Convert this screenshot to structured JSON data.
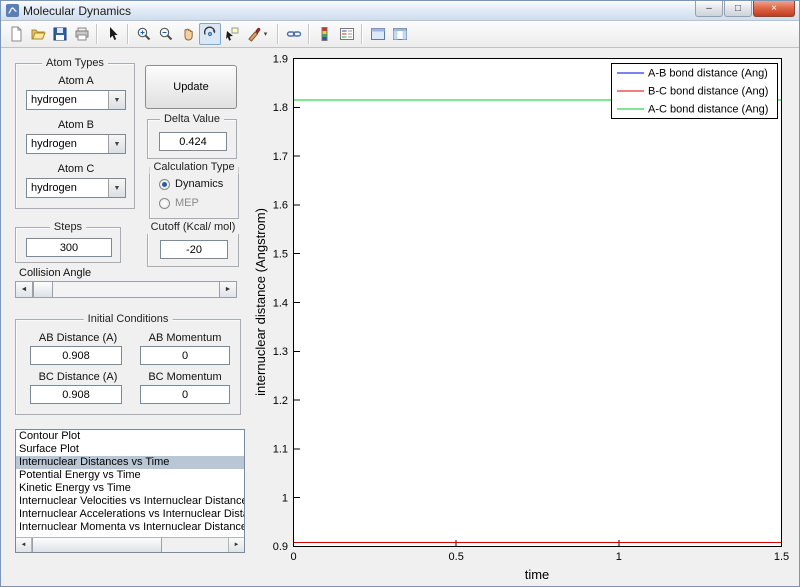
{
  "window": {
    "title": "Molecular Dynamics",
    "controls": {
      "minimize": "–",
      "maximize": "□",
      "close": "×"
    }
  },
  "toolbar": {
    "icons": [
      "new-figure",
      "open-file",
      "save-figure",
      "print-figure",
      "edit-plot",
      "zoom-in",
      "zoom-out",
      "pan",
      "rotate-3d",
      "data-cursor",
      "brush-data",
      "link-plot",
      "insert-colorbar",
      "insert-legend",
      "hide-plot-tools",
      "show-plot-tools"
    ]
  },
  "panels": {
    "atom_types": {
      "title": "Atom Types",
      "atoms": [
        {
          "label": "Atom A",
          "value": "hydrogen"
        },
        {
          "label": "Atom B",
          "value": "hydrogen"
        },
        {
          "label": "Atom C",
          "value": "hydrogen"
        }
      ]
    },
    "update_button": "Update",
    "delta": {
      "title": "Delta Value",
      "value": "0.424"
    },
    "calculation_type": {
      "title": "Calculation Type",
      "options": [
        {
          "label": "Dynamics",
          "selected": true
        },
        {
          "label": "MEP",
          "selected": false
        }
      ]
    },
    "steps": {
      "title": "Steps",
      "value": "300"
    },
    "cutoff": {
      "title": "Cutoff (Kcal/ mol)",
      "value": "-20"
    },
    "collision_angle": {
      "label": "Collision Angle"
    },
    "initial_conditions": {
      "title": "Initial Conditions",
      "fields": [
        {
          "label": "AB Distance (A)",
          "value": "0.908"
        },
        {
          "label": "AB Momentum",
          "value": "0"
        },
        {
          "label": "BC Distance (A)",
          "value": "0.908"
        },
        {
          "label": "BC Momentum",
          "value": "0"
        }
      ]
    },
    "plot_list": {
      "selected_index": 2,
      "items": [
        "Contour Plot",
        "Surface Plot",
        "Internuclear Distances vs Time",
        "Potential Energy vs Time",
        "Kinetic Energy vs Time",
        "Internuclear Velocities vs Internuclear Distance",
        "Internuclear Accelerations vs Internuclear Distance",
        "Internuclear Momenta vs Internuclear Distance"
      ]
    }
  },
  "chart_data": {
    "type": "line",
    "title": "",
    "xlabel": "time",
    "ylabel": "internuclear distance (Angstrom)",
    "xlim": [
      0,
      1.5
    ],
    "ylim": [
      0.9,
      1.9
    ],
    "xticks": [
      0,
      0.5,
      1,
      1.5
    ],
    "xtick_labels": [
      "0",
      "0.5",
      "1",
      "1.5"
    ],
    "yticks": [
      0.9,
      1,
      1.1,
      1.2,
      1.3,
      1.4,
      1.5,
      1.6,
      1.7,
      1.8,
      1.9
    ],
    "ytick_labels": [
      "0.9",
      "1",
      "1.1",
      "1.2",
      "1.3",
      "1.4",
      "1.5",
      "1.6",
      "1.7",
      "1.8",
      "1.9"
    ],
    "grid": false,
    "legend_position": "top-right",
    "series": [
      {
        "name": "A-B bond distance (Ang)",
        "color": "#0000dd",
        "shape": "constant",
        "value": 0.908,
        "x": [
          0,
          1.5
        ]
      },
      {
        "name": "B-C bond distance (Ang)",
        "color": "#dd0000",
        "shape": "constant",
        "value": 0.908,
        "x": [
          0,
          1.5
        ]
      },
      {
        "name": "A-C bond distance (Ang)",
        "color": "#00cc22",
        "shape": "constant",
        "value": 1.815,
        "x": [
          0,
          1.5
        ]
      }
    ]
  }
}
